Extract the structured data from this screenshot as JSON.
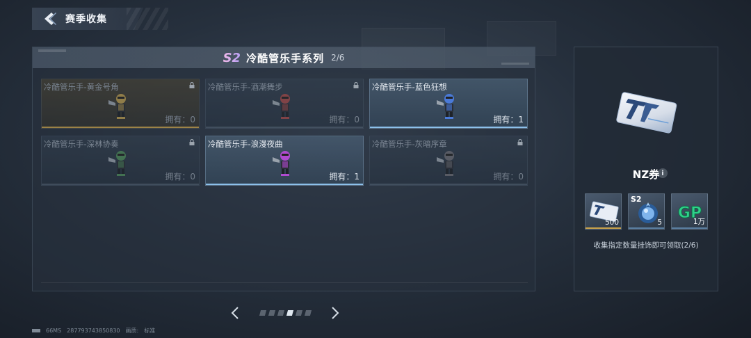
{
  "header": {
    "title": "赛季收集"
  },
  "series": {
    "badge": "S2",
    "title": "冷酷管乐手系列",
    "count": "2/6"
  },
  "cards": [
    {
      "name": "冷酷管乐手-黄金号角",
      "owned": "拥有：0",
      "state": "locked",
      "theme": "gold",
      "color": "#b89a4e"
    },
    {
      "name": "冷酷管乐手-酒潮舞步",
      "owned": "拥有：0",
      "state": "locked",
      "theme": "normal",
      "color": "#a04848"
    },
    {
      "name": "冷酷管乐手-蓝色狂想",
      "owned": "拥有：1",
      "state": "owned",
      "theme": "normal",
      "color": "#4a7ad8"
    },
    {
      "name": "冷酷管乐手-深林协奏",
      "owned": "拥有：0",
      "state": "locked",
      "theme": "normal",
      "color": "#4e8a5a"
    },
    {
      "name": "冷酷管乐手-浪漫夜曲",
      "owned": "拥有：1",
      "state": "owned",
      "theme": "normal",
      "color": "#b04ad0"
    },
    {
      "name": "冷酷管乐手-灰暗序章",
      "owned": "拥有：0",
      "state": "locked",
      "theme": "normal",
      "color": "#6a6a72"
    }
  ],
  "pager": {
    "total": 6,
    "active": 3
  },
  "footer": {
    "ping": "66MS",
    "uid": "287793743850830",
    "quality_label": "画质:",
    "quality_value": "标准"
  },
  "reward": {
    "name": "NZ券",
    "items": [
      {
        "icon": "nz-ticket-icon",
        "count": "500",
        "bar_color": "#c9a24a",
        "label": ""
      },
      {
        "icon": "blue-orb-icon",
        "count": "5",
        "bar_color": "#5a7ea0",
        "label": "S2"
      },
      {
        "icon": "gp-icon",
        "count": "1万",
        "bar_color": "#5a7ea0",
        "label": ""
      }
    ],
    "description": "收集指定数量挂饰即可领取(2/6)"
  },
  "colors": {
    "accent_blue": "#8cc0ea",
    "gold": "#c9a24a",
    "gp_green": "#2fd08a"
  }
}
